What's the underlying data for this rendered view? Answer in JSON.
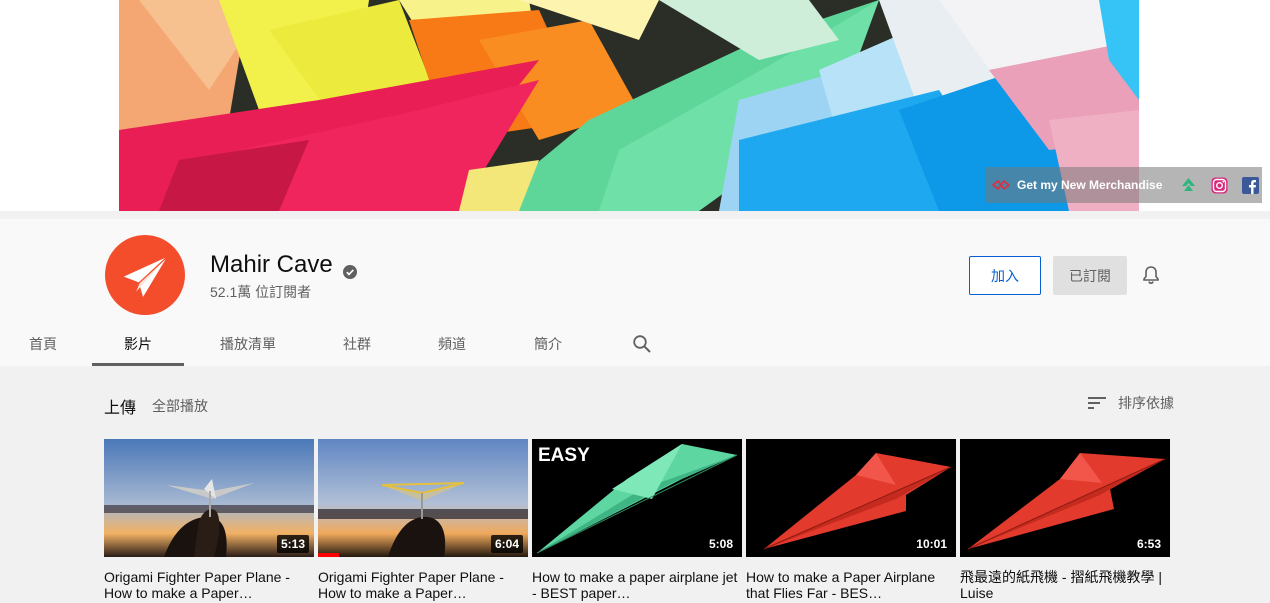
{
  "banner": {
    "merch_label": "Get my New Merchandise",
    "links": [
      {
        "icon": "merch-link-icon"
      },
      {
        "icon": "instagram-icon"
      },
      {
        "icon": "facebook-icon"
      }
    ]
  },
  "channel": {
    "name": "Mahir Cave",
    "subscribers": "52.1萬 位訂閱者",
    "join_label": "加入",
    "subscribed_label": "已訂閱"
  },
  "tabs": [
    {
      "label": "首頁"
    },
    {
      "label": "影片"
    },
    {
      "label": "播放清單"
    },
    {
      "label": "社群"
    },
    {
      "label": "頻道"
    },
    {
      "label": "簡介"
    }
  ],
  "active_tab": "影片",
  "uploads": {
    "title": "上傳",
    "play_all": "全部播放",
    "sort_label": "排序依據"
  },
  "videos": [
    {
      "title": "Origami Fighter Paper Plane - How to make a Paper…",
      "duration": "5:13",
      "watched_fraction": 0
    },
    {
      "title": "Origami Fighter Paper Plane - How to make a Paper…",
      "duration": "6:04",
      "watched_fraction": 0.1
    },
    {
      "title": "How to make a paper airplane jet - BEST paper…",
      "duration": "5:08",
      "thumb_text": "EASY",
      "watched_fraction": 0
    },
    {
      "title": "How to make a Paper Airplane that Flies Far - BES…",
      "duration": "10:01",
      "watched_fraction": 0
    },
    {
      "title": "飛最遠的紙飛機 - 摺紙飛機教學 | Luise",
      "duration": "6:53",
      "watched_fraction": 0
    }
  ],
  "colors": {
    "avatar_bg": "#f44d2c",
    "join_blue": "#065fd4",
    "progress_red": "#ff0000"
  }
}
